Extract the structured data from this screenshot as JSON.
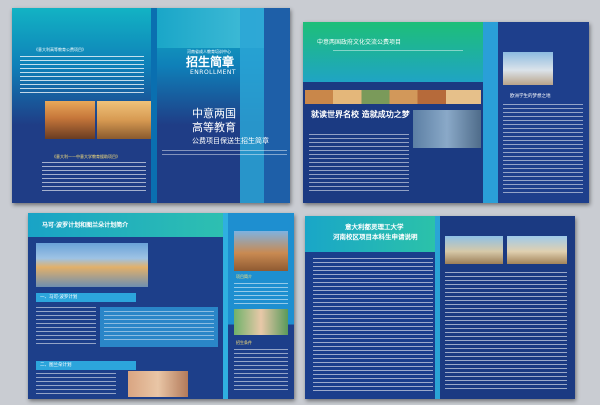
{
  "spread1": {
    "left_heading": "《意大利高等教育公费项目》",
    "center_subtitle": "河南省成人教育培训中心",
    "enroll_title": "招生简章",
    "enroll_en": "ENROLLMENT",
    "hero_line1": "中意两国",
    "hero_line2": "高等教育",
    "hero_line3": "公费项目保送生招生简章",
    "blue_bar_text": "《意大利——中意大学教育援助项目》"
  },
  "spread2": {
    "top_title": "中意两国政府文化交流公费项目",
    "slogan": "就读世界名校 造就成功之梦",
    "right_caption": "欧洲学生的梦想之地"
  },
  "spread3": {
    "title": "马可·波罗计划和图兰朵计划简介",
    "section1": "一、马可·波罗计划",
    "section2": "二、图兰朵计划",
    "label_project": "项目简介",
    "label_enroll": "招生条件"
  },
  "spread4": {
    "title_line1": "意大利都灵理工大学",
    "title_line2": "河南校区项目本科生申请说明"
  }
}
